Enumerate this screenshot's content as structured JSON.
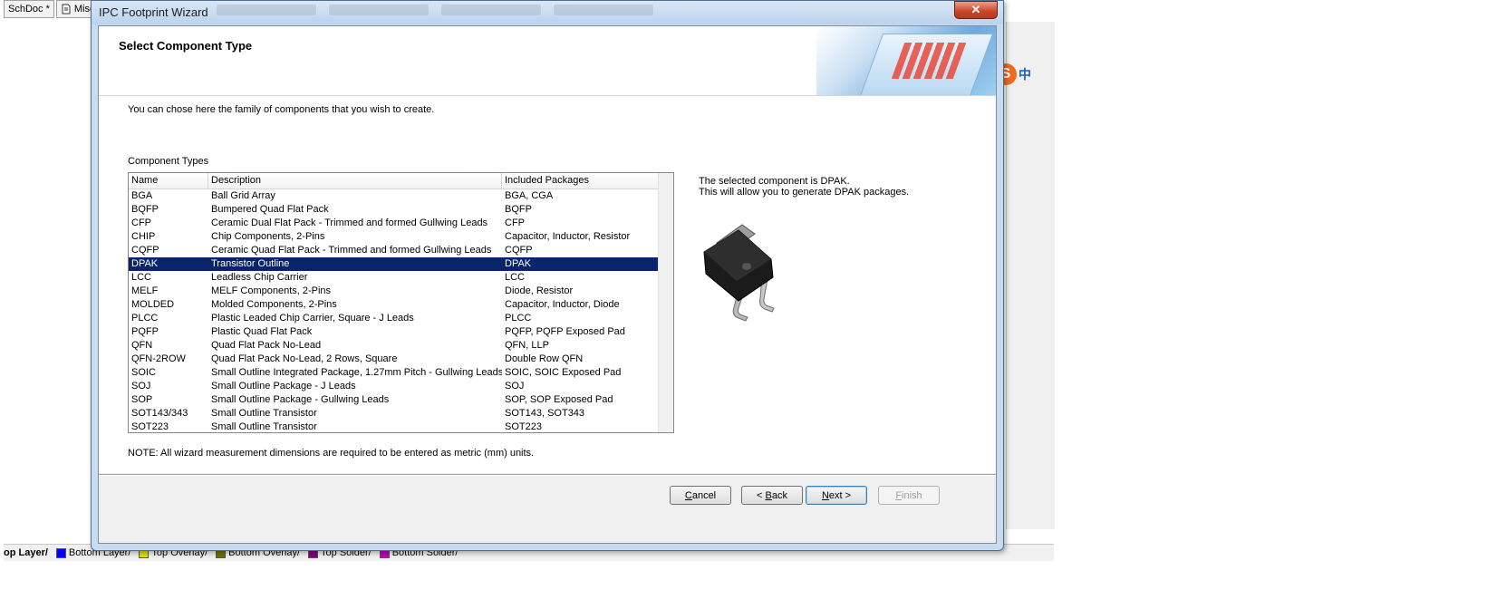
{
  "background": {
    "tabs": [
      {
        "label": "SchDoc *",
        "icon": ""
      },
      {
        "label": "Misc",
        "icon": "document-icon"
      }
    ],
    "layers": [
      {
        "label": "op Layer",
        "color": ""
      },
      {
        "label": "Bottom Layer",
        "color": "#0000ff"
      },
      {
        "label": "Top Overlay",
        "color": "#e0e000"
      },
      {
        "label": "Bottom Overlay",
        "color": "#707000"
      },
      {
        "label": "Top Solder",
        "color": "#800080"
      },
      {
        "label": "Bottom Solder",
        "color": "#c000c0"
      }
    ],
    "ime": {
      "logo": "S",
      "lang": "中"
    }
  },
  "dialog": {
    "title": "IPC Footprint Wizard",
    "close_label": "✕",
    "header_title": "Select Component Type",
    "intro": "You can chose here the family of components that you wish to create.",
    "component_types_label": "Component Types",
    "columns": [
      "Name",
      "Description",
      "Included Packages"
    ],
    "rows": [
      {
        "name": "BGA",
        "description": "Ball Grid Array",
        "packages": "BGA, CGA"
      },
      {
        "name": "BQFP",
        "description": "Bumpered Quad Flat Pack",
        "packages": "BQFP"
      },
      {
        "name": "CFP",
        "description": "Ceramic Dual Flat Pack - Trimmed and formed Gullwing Leads",
        "packages": "CFP"
      },
      {
        "name": "CHIP",
        "description": "Chip Components, 2-Pins",
        "packages": "Capacitor, Inductor, Resistor"
      },
      {
        "name": "CQFP",
        "description": "Ceramic Quad Flat Pack - Trimmed and formed Gullwing Leads",
        "packages": "CQFP"
      },
      {
        "name": "DPAK",
        "description": "Transistor Outline",
        "packages": "DPAK"
      },
      {
        "name": "LCC",
        "description": "Leadless Chip Carrier",
        "packages": "LCC"
      },
      {
        "name": "MELF",
        "description": "MELF Components, 2-Pins",
        "packages": "Diode, Resistor"
      },
      {
        "name": "MOLDED",
        "description": "Molded Components, 2-Pins",
        "packages": "Capacitor, Inductor, Diode"
      },
      {
        "name": "PLCC",
        "description": "Plastic Leaded Chip Carrier, Square - J Leads",
        "packages": "PLCC"
      },
      {
        "name": "PQFP",
        "description": "Plastic Quad Flat Pack",
        "packages": "PQFP, PQFP Exposed Pad"
      },
      {
        "name": "QFN",
        "description": "Quad Flat Pack No-Lead",
        "packages": "QFN, LLP"
      },
      {
        "name": "QFN-2ROW",
        "description": "Quad Flat Pack No-Lead, 2 Rows, Square",
        "packages": "Double Row QFN"
      },
      {
        "name": "SOIC",
        "description": "Small Outline Integrated Package, 1.27mm Pitch - Gullwing Leads",
        "packages": "SOIC, SOIC Exposed Pad"
      },
      {
        "name": "SOJ",
        "description": "Small Outline Package - J Leads",
        "packages": "SOJ"
      },
      {
        "name": "SOP",
        "description": "Small Outline Package - Gullwing Leads",
        "packages": "SOP, SOP Exposed Pad"
      },
      {
        "name": "SOT143/343",
        "description": "Small Outline Transistor",
        "packages": "SOT143, SOT343"
      },
      {
        "name": "SOT223",
        "description": "Small Outline Transistor",
        "packages": "SOT223"
      }
    ],
    "selected_row": "DPAK",
    "selected_info_line1": "The selected component is DPAK.",
    "selected_info_line2": "This will allow you to generate DPAK packages.",
    "note": "NOTE: All wizard measurement dimensions are required to be entered as metric (mm) units.",
    "buttons": {
      "cancel": {
        "hotkey": "C",
        "rest": "ancel"
      },
      "back": {
        "prefix": "< ",
        "hotkey": "B",
        "rest": "ack"
      },
      "next": {
        "hotkey": "N",
        "rest": "ext >"
      },
      "finish": {
        "hotkey": "F",
        "rest": "inish"
      }
    },
    "colors": {
      "selection": "#0a246a",
      "window_frame": "#c9dcef"
    }
  }
}
